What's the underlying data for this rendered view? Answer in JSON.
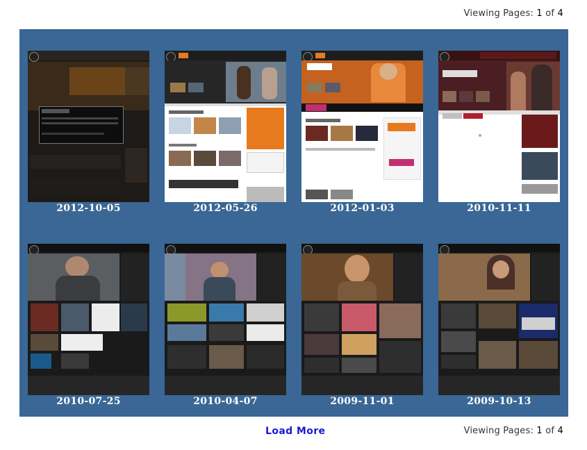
{
  "pager": {
    "label": "Viewing Pages:",
    "current": "1",
    "of_label": "of",
    "total": "4"
  },
  "snapshots": [
    {
      "date": "2012-10-05",
      "theme": "dark-modal"
    },
    {
      "date": "2012-05-26",
      "theme": "light-orange"
    },
    {
      "date": "2012-01-03",
      "theme": "light-orange-2"
    },
    {
      "date": "2010-11-11",
      "theme": "light-maroon"
    },
    {
      "date": "2010-07-25",
      "theme": "dark-grid"
    },
    {
      "date": "2010-04-07",
      "theme": "dark-grid-2"
    },
    {
      "date": "2009-11-01",
      "theme": "dark-grid-3"
    },
    {
      "date": "2009-10-13",
      "theme": "dark-grid-4"
    }
  ],
  "load_more_label": "Load More",
  "colors": {
    "panel": "#3a6795",
    "link": "#1a1ad4",
    "orange": "#e87a1e"
  }
}
